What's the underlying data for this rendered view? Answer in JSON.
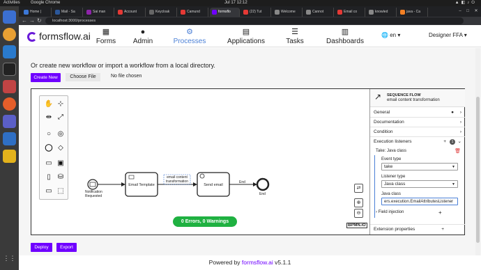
{
  "system": {
    "activities": "Activities",
    "app_name": "Google Chrome",
    "clock": "Jul 17  12:12"
  },
  "browser": {
    "tabs": [
      {
        "label": "Home |",
        "color": "#3c78d8"
      },
      {
        "label": "Mail - Sa",
        "color": "#2b579a"
      },
      {
        "label": "Sai man",
        "color": "#8e24aa"
      },
      {
        "label": "Account",
        "color": "#e53935"
      },
      {
        "label": "Keycloak",
        "color": "#666666"
      },
      {
        "label": "Camund",
        "color": "#e53935"
      },
      {
        "label": "formsflo",
        "color": "#6f00ff"
      },
      {
        "label": "(22) Tut",
        "color": "#e53935"
      },
      {
        "label": "Welcome",
        "color": "#888888"
      },
      {
        "label": "Cannot",
        "color": "#888888"
      },
      {
        "label": "Email co",
        "color": "#e53935"
      },
      {
        "label": "knowled",
        "color": "#888888"
      },
      {
        "label": "java - Ca",
        "color": "#f48024"
      }
    ],
    "url": "localhost:3000/processes"
  },
  "header": {
    "logo": "formsflow.ai",
    "nav": [
      {
        "label": "Forms",
        "icon": "forms-icon"
      },
      {
        "label": "Admin",
        "icon": "admin-icon"
      },
      {
        "label": "Processes",
        "icon": "processes-icon"
      },
      {
        "label": "Applications",
        "icon": "applications-icon"
      },
      {
        "label": "Tasks",
        "icon": "tasks-icon"
      },
      {
        "label": "Dashboards",
        "icon": "dashboards-icon"
      }
    ],
    "lang": "en",
    "user": "Designer FFA"
  },
  "main": {
    "intro": "Or create new workflow or import a workflow from a local directory.",
    "create_new": "Create New",
    "choose_file": "Choose File",
    "no_file": "No file chosen",
    "deploy": "Deploy",
    "export": "Export"
  },
  "diagram": {
    "start_label_1": "Notification",
    "start_label_2": "Requested",
    "task1": "Email Template",
    "flow_label_1": "email content",
    "flow_label_2": "transformation",
    "task2": "Send email",
    "end_flow": "End",
    "end_label": "End",
    "status": "0 Errors, 0 Warnings",
    "watermark": "BPMN.iO"
  },
  "props": {
    "type": "SEQUENCE FLOW",
    "name": "email content transformation",
    "groups": [
      "General",
      "Documentation",
      "Condition",
      "Execution listeners"
    ],
    "listener_count": "1",
    "listener_title": "Take: Java class",
    "event_type_label": "Event type",
    "event_type_value": "take",
    "listener_type_label": "Listener type",
    "listener_type_value": "Java class",
    "java_class_label": "Java class",
    "java_class_value": "ers.execution.EmailAttributesListener",
    "field_injection": "Field injection",
    "extension": "Extension properties"
  },
  "footer": {
    "prefix": "Powered by ",
    "brand": "formsflow.ai",
    "version": " v5.1.1"
  }
}
